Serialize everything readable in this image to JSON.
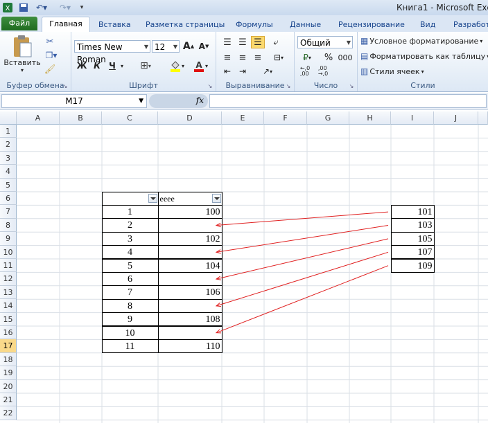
{
  "window": {
    "title": "Книга1  -  Microsoft Excel"
  },
  "tabs": [
    "Файл",
    "Главная",
    "Вставка",
    "Разметка страницы",
    "Формулы",
    "Данные",
    "Рецензирование",
    "Вид",
    "Разработ"
  ],
  "ribbon": {
    "clipboard": {
      "label": "Буфер обмена",
      "paste": "Вставить"
    },
    "font": {
      "label": "Шрифт",
      "name": "Times New Roman",
      "size": "12",
      "bold": "Ж",
      "italic": "К",
      "underline": "Ч"
    },
    "alignment": {
      "label": "Выравнивание"
    },
    "number": {
      "label": "Число",
      "format": "Общий",
      "percent": "%",
      "thousands": "000"
    },
    "styles": {
      "label": "Стили",
      "conditional": "Условное форматирование",
      "as_table": "Форматировать как таблицу",
      "cell_styles": "Стили ячеек"
    }
  },
  "formula_bar": {
    "name_box": "M17",
    "fx": "fx",
    "value": ""
  },
  "columns": [
    "A",
    "B",
    "C",
    "D",
    "E",
    "F",
    "G",
    "H",
    "I",
    "J"
  ],
  "rows": [
    "1",
    "2",
    "3",
    "4",
    "5",
    "6",
    "7",
    "8",
    "9",
    "10",
    "11",
    "12",
    "13",
    "14",
    "15",
    "16",
    "17",
    "18",
    "19",
    "20",
    "21",
    "22"
  ],
  "table": {
    "header_d": "eeee",
    "c_values": [
      "1",
      "2",
      "3",
      "4",
      "5",
      "6",
      "7",
      "8",
      "9",
      "10",
      "11"
    ],
    "d_values": [
      "100",
      "",
      "102",
      "",
      "104",
      "",
      "106",
      "",
      "108",
      "",
      "110"
    ]
  },
  "side_values": [
    "101",
    "103",
    "105",
    "107",
    "109"
  ],
  "colors": {
    "arrow": "#e02020",
    "selected_header": "#f9d98a",
    "file_tab": "#2a7a2a"
  }
}
